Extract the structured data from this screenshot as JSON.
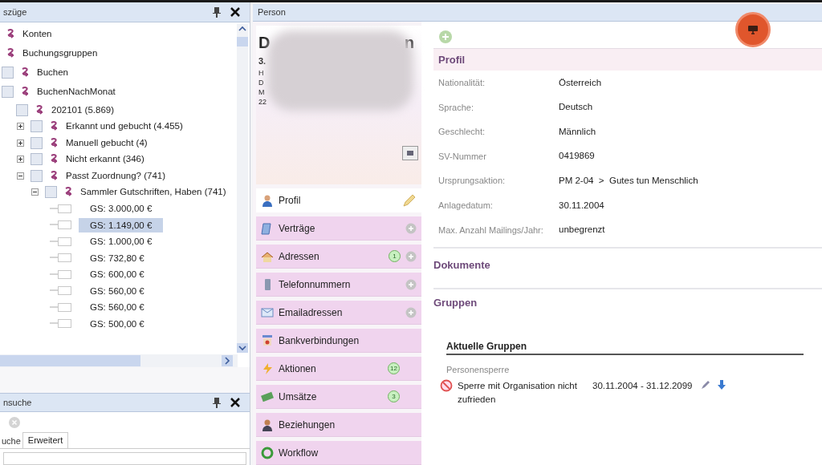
{
  "left_panel": {
    "title": "szüge",
    "tree": [
      {
        "label": "Konten",
        "checkbox": false
      },
      {
        "label": "Buchungsgruppen",
        "checkbox": false,
        "children": [
          {
            "label": "Buchen",
            "checkbox": true
          },
          {
            "label": "BuchenNachMonat",
            "checkbox": true,
            "children": [
              {
                "label": "202101 (5.869)",
                "checkbox": true,
                "children": [
                  {
                    "label": "Erkannt und gebucht (4.455)",
                    "checkbox": true,
                    "expanded": false
                  },
                  {
                    "label": "Manuell gebucht (4)",
                    "checkbox": true,
                    "expanded": false
                  },
                  {
                    "label": "Nicht erkannt (346)",
                    "checkbox": true,
                    "expanded": false
                  },
                  {
                    "label": "Passt Zuordnung? (741)",
                    "checkbox": true,
                    "expanded": true,
                    "children": [
                      {
                        "label": "Sammler Gutschriften, Haben (741)",
                        "checkbox": true,
                        "expanded": true,
                        "children": [
                          {
                            "label": "GS: 3.000,00 €",
                            "kind": "leaf",
                            "selected": false
                          },
                          {
                            "label": "GS: 1.149,00 €",
                            "kind": "leaf",
                            "selected": true
                          },
                          {
                            "label": "GS: 1.000,00 €",
                            "kind": "leaf",
                            "selected": false
                          },
                          {
                            "label": "GS: 732,80 €",
                            "kind": "leaf",
                            "selected": false
                          },
                          {
                            "label": "GS: 600,00 €",
                            "kind": "leaf",
                            "selected": false
                          },
                          {
                            "label": "GS: 560,00 €",
                            "kind": "leaf",
                            "selected": false
                          },
                          {
                            "label": "GS: 560,00 €",
                            "kind": "leaf",
                            "selected": false
                          },
                          {
                            "label": "GS: 500,00 €",
                            "kind": "leaf",
                            "selected": false
                          }
                        ]
                      }
                    ]
                  }
                ]
              }
            ]
          }
        ]
      }
    ]
  },
  "search_panel": {
    "title": "nsuche",
    "tabs": [
      {
        "label": "uche",
        "selected": false
      },
      {
        "label": "Erweitert",
        "selected": true
      }
    ]
  },
  "person": {
    "title": "Person",
    "card": {
      "name_start": "D",
      "name_end": "n",
      "number": "3.",
      "lines": [
        "H",
        "D",
        "M",
        "22"
      ]
    },
    "nav": [
      {
        "label": "Profil",
        "selected": true,
        "edit": true,
        "add": false
      },
      {
        "label": "Verträge",
        "selected": false,
        "add": true
      },
      {
        "label": "Adressen",
        "selected": false,
        "badge": "1",
        "add": true
      },
      {
        "label": "Telefonnummern",
        "selected": false,
        "add": true
      },
      {
        "label": "Emailadressen",
        "selected": false,
        "add": true
      },
      {
        "label": "Bankverbindungen",
        "selected": false,
        "add": false
      },
      {
        "label": "Aktionen",
        "selected": false,
        "badge": "12",
        "add": false
      },
      {
        "label": "Umsätze",
        "selected": false,
        "badge": "3",
        "add": false
      },
      {
        "label": "Beziehungen",
        "selected": false,
        "add": false
      },
      {
        "label": "Workflow",
        "selected": false,
        "add": false
      }
    ],
    "profile": {
      "title": "Profil",
      "rows": [
        {
          "label": "Nationalität:",
          "value": "Österreich"
        },
        {
          "label": "Sprache:",
          "value": "Deutsch"
        },
        {
          "label": "Geschlecht:",
          "value": "Männlich"
        },
        {
          "label": "SV-Nummer",
          "value": "0419869"
        },
        {
          "label": "Ursprungsaktion:",
          "value": "PM 2-04  >  Gutes tun Menschlich"
        },
        {
          "label": "Anlagedatum:",
          "value": "30.11.2004"
        },
        {
          "label": "Max. Anzahl Mailings/Jahr:",
          "value": "unbegrenzt"
        }
      ]
    },
    "documents": {
      "title": "Dokumente"
    },
    "groups": {
      "title": "Gruppen",
      "subtitle": "Aktuelle Gruppen",
      "category": "Personensperre",
      "entries": [
        {
          "name": "Sperre mit Organisation nicht zufrieden",
          "period": "30.11.2004 - 31.12.2099"
        }
      ]
    }
  }
}
